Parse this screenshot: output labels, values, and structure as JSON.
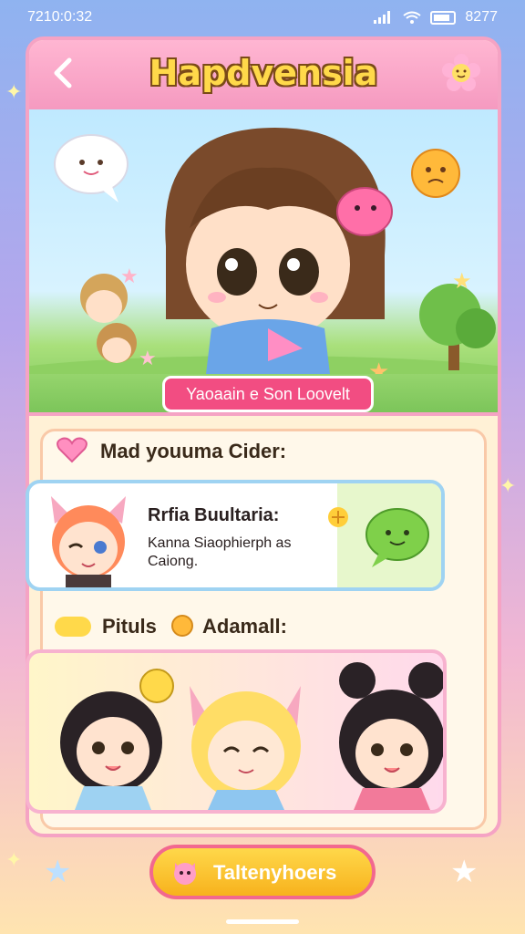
{
  "status_bar": {
    "time": "7210:0:32",
    "battery_text": "8277"
  },
  "header": {
    "title": "Hapdvensia"
  },
  "hero": {
    "caption": "Yaoaain e Son Loovelt"
  },
  "section1": {
    "title": "Mad youuma Cider:"
  },
  "character_row": {
    "name": "Rrfia Buultaria:",
    "description": "Kanna Siaophierph as Caiong."
  },
  "section2": {
    "title": "Pituls",
    "title_suffix": "Adamall:"
  },
  "cta": {
    "label": "Taltenyhoers"
  },
  "colors": {
    "accent_pink": "#f24d82",
    "header_pink": "#f59ac0",
    "cta_yellow": "#f7b21d"
  }
}
